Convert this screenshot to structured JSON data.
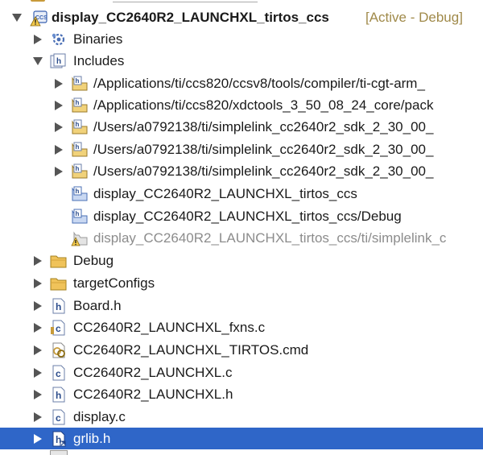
{
  "tree": {
    "project": {
      "name": "display_CC2640R2_LAUNCHXL_tirtos_ccs",
      "decoration": "[Active - Debug]",
      "badge": "CCS"
    },
    "binaries": {
      "label": "Binaries"
    },
    "includes": {
      "label": "Includes",
      "items": [
        "/Applications/ti/ccs820/ccsv8/tools/compiler/ti-cgt-arm_",
        "/Applications/ti/ccs820/xdctools_3_50_08_24_core/pack",
        "/Users/a0792138/ti/simplelink_cc2640r2_sdk_2_30_00_",
        "/Users/a0792138/ti/simplelink_cc2640r2_sdk_2_30_00_",
        "/Users/a0792138/ti/simplelink_cc2640r2_sdk_2_30_00_",
        "display_CC2640R2_LAUNCHXL_tirtos_ccs",
        "display_CC2640R2_LAUNCHXL_tirtos_ccs/Debug",
        "display_CC2640R2_LAUNCHXL_tirtos_ccs/ti/simplelink_c"
      ]
    },
    "folders": [
      "Debug",
      "targetConfigs"
    ],
    "files": [
      "Board.h",
      "CC2640R2_LAUNCHXL_fxns.c",
      "CC2640R2_LAUNCHXL_TIRTOS.cmd",
      "CC2640R2_LAUNCHXL.c",
      "CC2640R2_LAUNCHXL.h",
      "display.c",
      "grlib.h"
    ],
    "icon_glyphs": {
      "header": "h",
      "source": "c"
    }
  },
  "colors": {
    "selection": "#2f66c8",
    "folder": "#e8b64a",
    "decoration": "#a08a4a",
    "muted": "#8c8c8c"
  }
}
